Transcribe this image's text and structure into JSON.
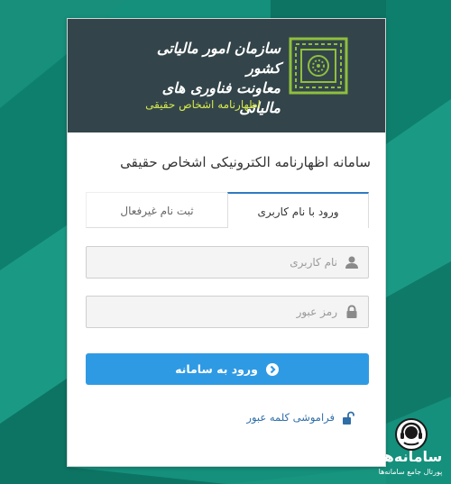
{
  "header": {
    "org_name_line1": "سازمان امور مالیاتی کشور",
    "org_name_line2": "معاونت فناوری های مالیاتی",
    "subtitle": "اظهارنامه اشخاص حقیقی"
  },
  "page_title": "سامانه اظهارنامه الکترونیکی اشخاص حقیقی",
  "tabs": [
    {
      "label": "ورود با نام کاربری",
      "active": true
    },
    {
      "label": "ثبت نام غیرفعال",
      "active": false
    }
  ],
  "form": {
    "username_placeholder": "نام کاربری",
    "username_value": "",
    "password_placeholder": "رمز عبور",
    "password_value": ""
  },
  "login_button_label": "ورود به سامانه",
  "forgot_password_label": "فراموشی کلمه عبور",
  "watermark": {
    "brand": "سامانه‌ها",
    "tagline": "پورتال جامع سامانه‌ها"
  },
  "colors": {
    "background": "#14907c",
    "header": "#33454a",
    "accent_button": "#2f9ae4",
    "subtitle": "#d6e84d",
    "link": "#2f6ea8",
    "emblem": "#8fbf3d"
  },
  "icons": {
    "emblem": "tax-organization-emblem",
    "username_field": "user-icon",
    "password_field": "lock-icon",
    "login_button": "arrow-circle-right-icon",
    "forgot_password": "unlock-icon",
    "watermark": "headset-icon"
  }
}
